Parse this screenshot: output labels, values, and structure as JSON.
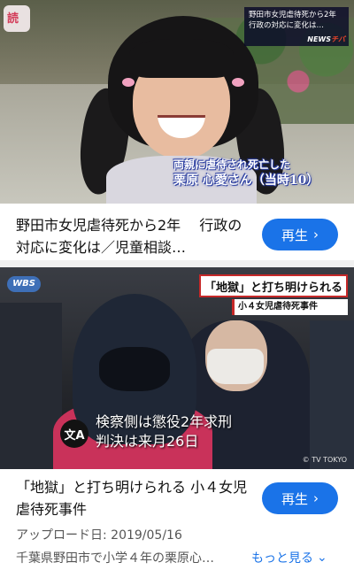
{
  "cards": [
    {
      "thumbnail": {
        "logo_text": "読",
        "news_headline_1": "野田市女児虐待死から2年",
        "news_headline_2": "行政の対応に変化は…",
        "news_brand_prefix": "NEWS",
        "news_brand_suffix": "チバ",
        "caption_line_1": "両親に虐待され死亡した",
        "caption_line_2": "栗原 心愛さん（当時10）"
      },
      "title": "野田市女児虐待死から2年　 行政の対応に変化は／児童相談…",
      "button_label": "再生",
      "button_icon": "chevron-right-icon"
    },
    {
      "thumbnail": {
        "logo_text": "WBS",
        "banner": "「地獄」と打ち明けられる",
        "sub_banner": "小４女児虐待死事件",
        "translate_icon_text": "文A",
        "caption_line_1": "検察側は懲役2年求刑",
        "caption_line_2": "判決は来月26日",
        "copyright": "© TV TOKYO"
      },
      "title": "「地獄」と打ち明けられる 小４女児虐待死事件",
      "button_label": "再生",
      "button_icon": "chevron-right-icon",
      "upload_label": "アップロード日: 2019/05/16",
      "description": "千葉県野田市で小学４年の栗原心…",
      "more_label": "もっと見る"
    }
  ],
  "colors": {
    "accent": "#1a73e8",
    "banner_border": "#c62828"
  }
}
